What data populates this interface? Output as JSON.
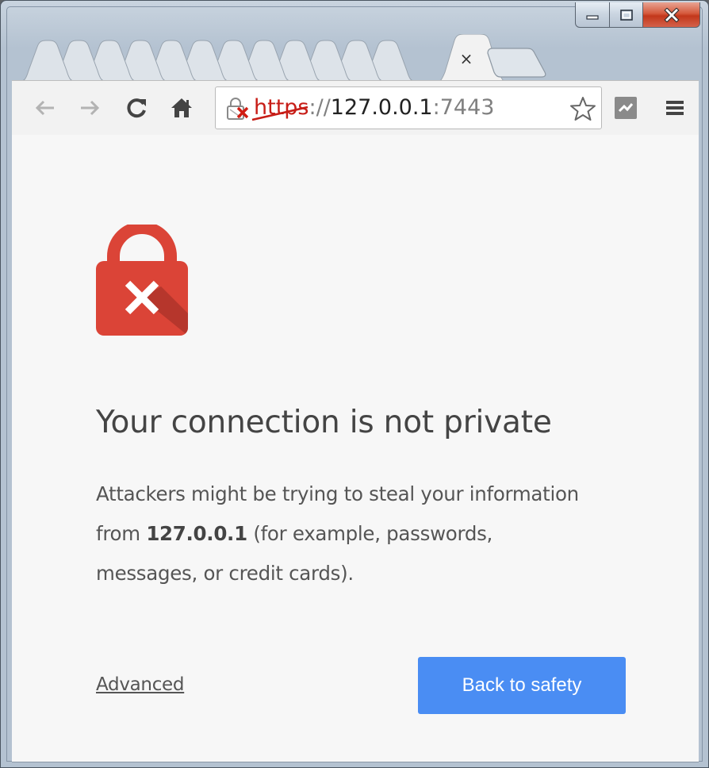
{
  "window": {
    "caption_buttons": {
      "minimize_icon": "minimize-icon",
      "maximize_icon": "maximize-icon",
      "close_icon": "close-icon"
    }
  },
  "tabs": {
    "active_tab_close": "×",
    "background_tab_count": 12
  },
  "toolbar": {
    "back_icon": "back-arrow-icon",
    "forward_icon": "forward-arrow-icon",
    "reload_icon": "reload-icon",
    "home_icon": "home-icon",
    "extension_icon": "extension-icon",
    "menu_icon": "hamburger-menu-icon"
  },
  "omnibox": {
    "scheme": "https",
    "separator": "://",
    "host": "127.0.0.1",
    "port": ":7443",
    "security_icon": "broken-lock-icon",
    "bookmark_icon": "star-icon"
  },
  "interstitial": {
    "heading": "Your connection is not private",
    "body_before_host": "Attackers might be trying to steal your information from ",
    "body_host": "127.0.0.1",
    "body_after_host": " (for example, passwords, messages, or credit cards).",
    "advanced_link": "Advanced",
    "primary_button": "Back to safety",
    "lock_icon": "red-lock-x-icon"
  },
  "colors": {
    "lock_red": "#db4437",
    "button_blue": "#4a8df3",
    "url_scheme_red": "#c71d17"
  }
}
